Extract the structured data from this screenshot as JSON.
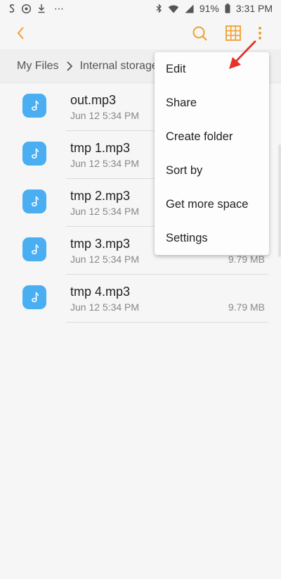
{
  "status_bar": {
    "battery": "91%",
    "time": "3:31 PM",
    "dots": "⋯"
  },
  "app_bar": {
    "accent": "#f0a030"
  },
  "breadcrumb": {
    "root": "My Files",
    "current": "Internal storage"
  },
  "files": [
    {
      "name": "out.mp3",
      "date": "Jun 12 5:34 PM",
      "size": ""
    },
    {
      "name": "tmp 1.mp3",
      "date": "Jun 12 5:34 PM",
      "size": ""
    },
    {
      "name": "tmp 2.mp3",
      "date": "Jun 12 5:34 PM",
      "size": ""
    },
    {
      "name": "tmp 3.mp3",
      "date": "Jun 12 5:34 PM",
      "size": "9.79 MB"
    },
    {
      "name": "tmp 4.mp3",
      "date": "Jun 12 5:34 PM",
      "size": "9.79 MB"
    }
  ],
  "menu": {
    "items": [
      {
        "label": "Edit"
      },
      {
        "label": "Share"
      },
      {
        "label": "Create folder"
      },
      {
        "label": "Sort by"
      },
      {
        "label": "Get more space"
      },
      {
        "label": "Settings"
      }
    ]
  },
  "colors": {
    "file_icon": "#4aaef3",
    "annotation_arrow": "#e5322b"
  }
}
